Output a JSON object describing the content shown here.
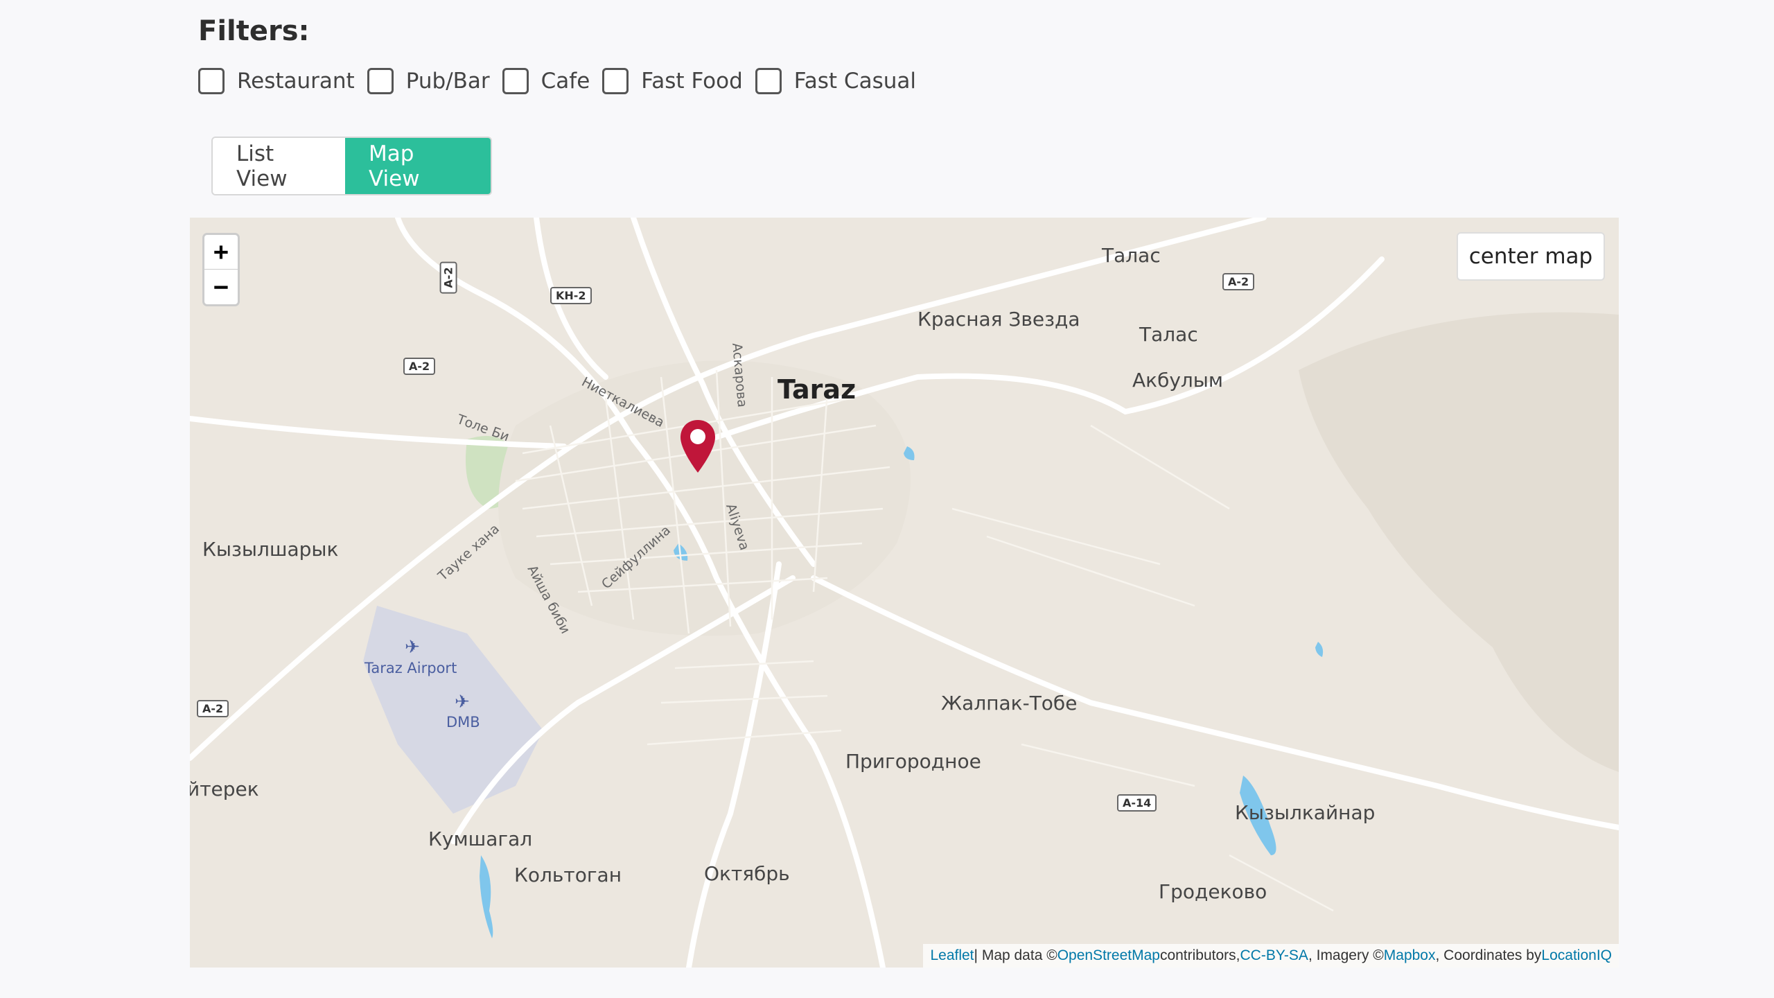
{
  "filters": {
    "title": "Filters:",
    "options": [
      {
        "label": "Restaurant",
        "checked": false
      },
      {
        "label": "Pub/Bar",
        "checked": false
      },
      {
        "label": "Cafe",
        "checked": false
      },
      {
        "label": "Fast Food",
        "checked": false
      },
      {
        "label": "Fast Casual",
        "checked": false
      }
    ]
  },
  "view_toggle": {
    "list_label": "List View",
    "map_label": "Map View",
    "active": "map"
  },
  "map": {
    "zoom_in": "+",
    "zoom_out": "−",
    "center_label": "center map",
    "labels": {
      "taraz": "Taraz",
      "talas1": "Талас",
      "talas2": "Талас",
      "krasnaya": "Красная Звезда",
      "akbulym": "Акбулым",
      "kyzylsharyk": "Кызылшарык",
      "taraz_airport": "Taraz Airport",
      "dmb": "DMB",
      "terek": "йтерек",
      "zhalpak": "Жалпак-Тобе",
      "prigorodnoe": "Пригородное",
      "kyzylkaynar": "Кызылкайнар",
      "kumshagal": "Кумшагал",
      "koltogan": "Кольтоган",
      "oktyabr": "Октябрь",
      "grodekovo": "Гродеково",
      "askarova": "Аскарова",
      "niyetkalieva": "Ниеткалиева",
      "tole_bi": "Толе Би",
      "tauke": "Тауке хана",
      "ayisha": "Айша биби",
      "seyfullina": "Сейфуллина",
      "aliyeva": "Aliyeva"
    },
    "shields": {
      "a2_top": "A-2",
      "a2_left": "A-2",
      "kn2": "KH-2",
      "a2_right": "A-2",
      "a2_bottom": "A-2",
      "a14": "A-14"
    },
    "marker_color": "#c0163a",
    "attribution": {
      "leaflet": "Leaflet",
      "sep1": " | Map data © ",
      "osm": "OpenStreetMap",
      "contrib": " contributors, ",
      "ccbysa": "CC-BY-SA",
      "imagery": ", Imagery © ",
      "mapbox": "Mapbox",
      "coords": ", Coordinates by ",
      "locationiq": "LocationIQ"
    }
  },
  "colors": {
    "accent": "#2cbf9b",
    "link": "#0078a8"
  }
}
